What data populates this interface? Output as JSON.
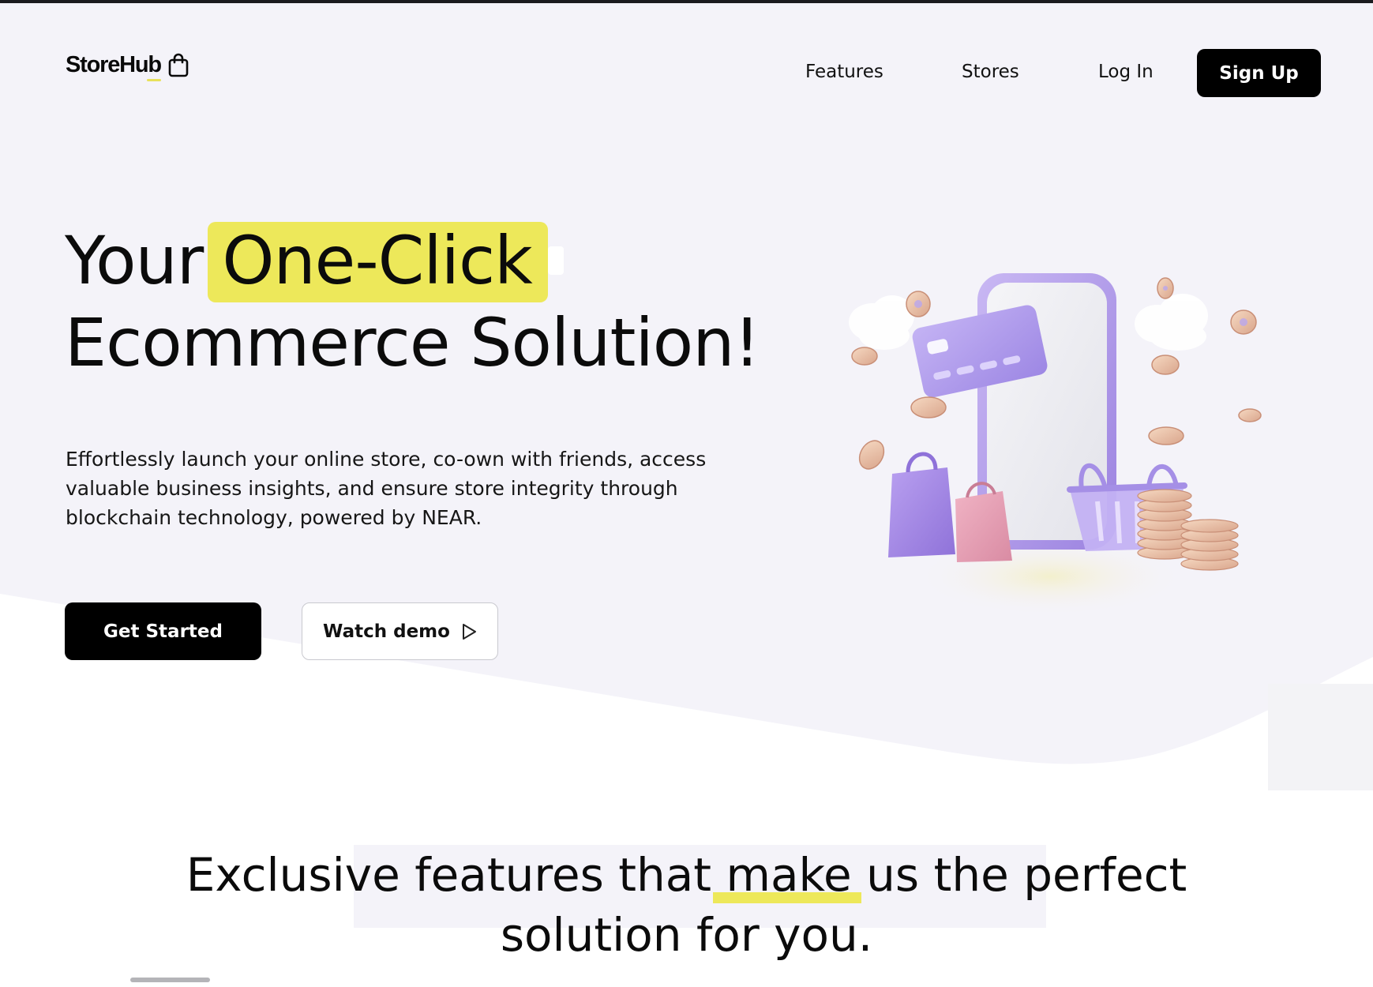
{
  "brand": {
    "name": "StoreHub",
    "logo_icon": "shopping-bag-icon"
  },
  "nav": {
    "items": [
      {
        "label": "Features"
      },
      {
        "label": "Stores"
      },
      {
        "label": "Log In"
      }
    ],
    "signup_label": "Sign Up"
  },
  "hero": {
    "headline_prefix": "Your",
    "headline_highlight": "One-Click",
    "headline_line2": "Ecommerce Solution!",
    "description": "Effortlessly launch your online store, co-own with friends, access valuable business insights, and ensure store integrity through blockchain technology, powered by NEAR.",
    "primary_cta": "Get Started",
    "secondary_cta": "Watch demo",
    "secondary_cta_icon": "play-outline-icon",
    "illustration": "phone-shopping-illustration"
  },
  "features": {
    "heading_part1": "Exclusive features that",
    "heading_underlined": "make",
    "heading_part2": "us the perfect",
    "heading_line2": "solution for you."
  },
  "colors": {
    "accent_yellow": "#ede85a",
    "hero_background": "#f4f3f9",
    "button_black": "#000000",
    "illustration_purple": "#b9a6ee"
  }
}
